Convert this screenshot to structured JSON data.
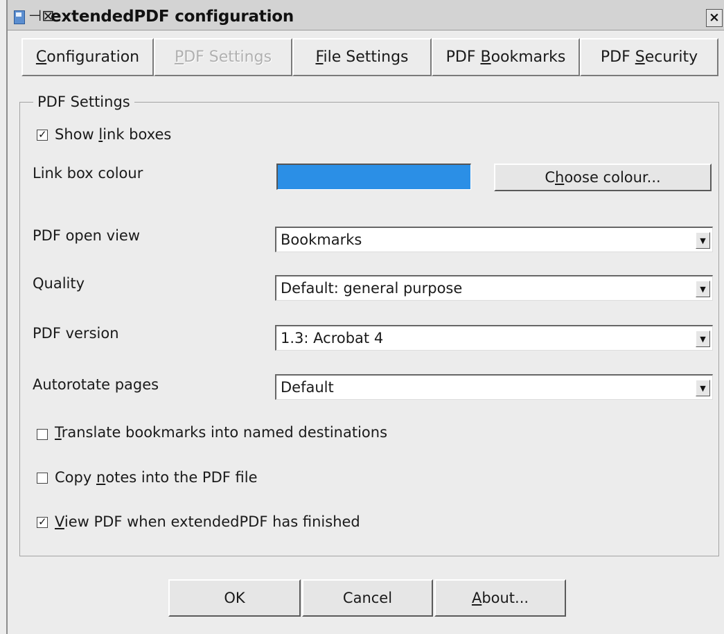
{
  "window": {
    "title": "extendedPDF configuration",
    "close_label": "×"
  },
  "tabs": [
    {
      "pre": "",
      "mnemonic": "C",
      "post": "onfiguration",
      "disabled": false
    },
    {
      "pre": "",
      "mnemonic": "P",
      "post": "DF Settings",
      "disabled": true
    },
    {
      "pre": "",
      "mnemonic": "F",
      "post": "ile Settings",
      "disabled": false
    },
    {
      "pre": "PDF ",
      "mnemonic": "B",
      "post": "ookmarks",
      "disabled": false
    },
    {
      "pre": "PDF ",
      "mnemonic": "S",
      "post": "ecurity",
      "disabled": false
    }
  ],
  "group": {
    "title": "PDF Settings"
  },
  "show_link_boxes": {
    "pre": "Show ",
    "mnemonic": "l",
    "post": "ink boxes",
    "checked": true
  },
  "link_box_colour": {
    "label": "Link box colour",
    "color": "#2b8fe6"
  },
  "choose_colour": {
    "pre": "C",
    "mnemonic": "h",
    "post": "oose colour..."
  },
  "fields": {
    "open_view": {
      "label": "PDF open view",
      "value": "Bookmarks"
    },
    "quality": {
      "label": "Quality",
      "value": "Default: general purpose"
    },
    "version": {
      "label": "PDF version",
      "value": "1.3: Acrobat 4"
    },
    "autorotate": {
      "label": "Autorotate pages",
      "value": "Default"
    }
  },
  "options": {
    "translate": {
      "pre": "",
      "mnemonic": "T",
      "post": "ranslate bookmarks into named destinations",
      "checked": false
    },
    "copy_notes": {
      "pre": "Copy ",
      "mnemonic": "n",
      "post": "otes into the PDF file",
      "checked": false
    },
    "view_pdf": {
      "pre": "",
      "mnemonic": "V",
      "post": "iew PDF when extendedPDF has finished",
      "checked": true
    }
  },
  "buttons": {
    "ok": {
      "pre": "OK",
      "mnemonic": "",
      "post": ""
    },
    "cancel": {
      "pre": "Cancel",
      "mnemonic": "",
      "post": ""
    },
    "about": {
      "pre": "",
      "mnemonic": "A",
      "post": "bout..."
    }
  },
  "icons": {
    "check": "✓",
    "dropdown": "▼",
    "pin": "⊣⊠"
  }
}
